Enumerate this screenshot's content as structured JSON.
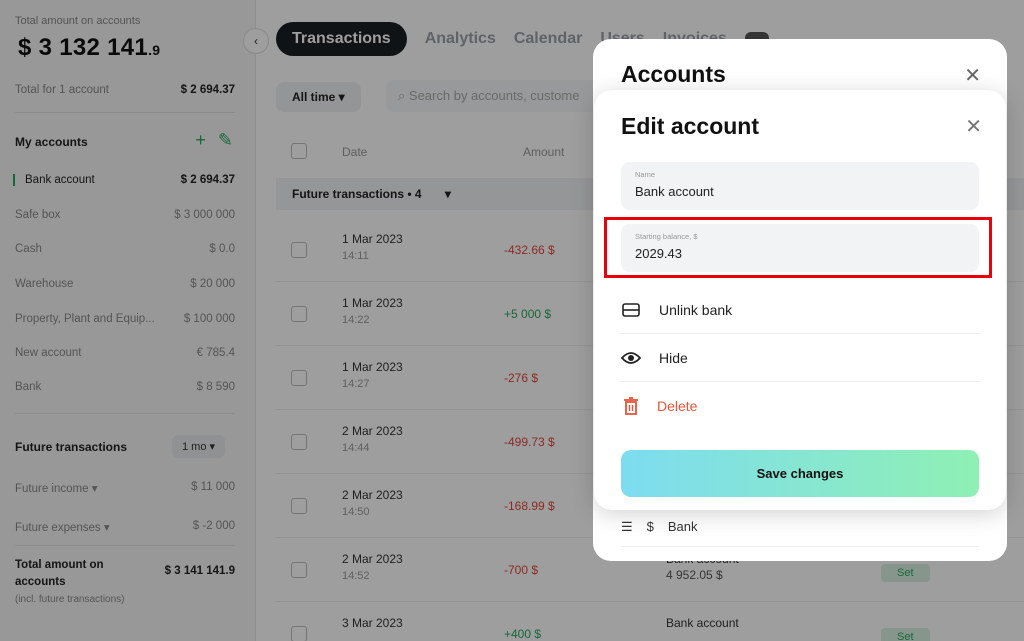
{
  "sidebar": {
    "total_label": "Total amount on accounts",
    "total_main": "$ 3 132 141",
    "total_frac": ".9",
    "total_for_label": "Total for 1 account",
    "total_for_value": "$ 2 694.37",
    "my_accounts_heading": "My accounts",
    "accounts": [
      {
        "name": "Bank account",
        "value": "$ 2 694.37"
      },
      {
        "name": "Safe box",
        "value": "$ 3 000 000"
      },
      {
        "name": "Cash",
        "value": "$ 0.0"
      },
      {
        "name": "Warehouse",
        "value": "$ 20 000"
      },
      {
        "name": "Property, Plant and Equip...",
        "value": "$ 100 000"
      },
      {
        "name": "New account",
        "value": "€ 785.4"
      },
      {
        "name": "Bank",
        "value": "$ 8 590"
      }
    ],
    "future_heading": "Future transactions",
    "future_period": "1 mo",
    "future_income_label": "Future income",
    "future_income_value": "$ 11 000",
    "future_expenses_label": "Future expenses",
    "future_expenses_value": "$ -2 000",
    "total_future_label": "Total amount on accounts",
    "total_future_value": "$ 3 141 141.9",
    "total_future_note": "(incl. future transactions)"
  },
  "tabs": [
    "Transactions",
    "Analytics",
    "Calendar",
    "Users",
    "Invoices"
  ],
  "filter": {
    "period": "All time",
    "search_placeholder": "Search by accounts, custome"
  },
  "table": {
    "headers": {
      "date": "Date",
      "amount": "Amount"
    },
    "group_label": "Future transactions • 4",
    "rows": [
      {
        "date": "1 Mar 2023",
        "time": "14:11",
        "amount": "-432.66 $",
        "sign": "neg",
        "account": "",
        "account_value": ""
      },
      {
        "date": "1 Mar 2023",
        "time": "14:22",
        "amount": "+5 000 $",
        "sign": "pos",
        "account": "",
        "account_value": ""
      },
      {
        "date": "1 Mar 2023",
        "time": "14:27",
        "amount": "-276 $",
        "sign": "neg",
        "account": "",
        "account_value": ""
      },
      {
        "date": "2 Mar 2023",
        "time": "14:44",
        "amount": "-499.73 $",
        "sign": "neg",
        "account": "",
        "account_value": ""
      },
      {
        "date": "2 Mar 2023",
        "time": "14:50",
        "amount": "-168.99 $",
        "sign": "neg",
        "account": "",
        "account_value": ""
      },
      {
        "date": "2 Mar 2023",
        "time": "14:52",
        "amount": "-700 $",
        "sign": "neg",
        "account": "Bank account",
        "account_value": "4 952.05 $"
      },
      {
        "date": "3 Mar 2023",
        "time": "",
        "amount": "+400 $",
        "sign": "pos",
        "account": "Bank account",
        "account_value": ""
      }
    ],
    "set_label": "Set"
  },
  "accounts_modal": {
    "title": "Accounts",
    "visible_row": {
      "currency": "$",
      "name": "Bank"
    }
  },
  "edit_modal": {
    "title": "Edit account",
    "name_label": "Name",
    "name_value": "Bank account",
    "balance_label": "Starting balance, $",
    "balance_value": "2029.43",
    "unlink_label": "Unlink bank",
    "hide_label": "Hide",
    "delete_label": "Delete",
    "save_label": "Save changes"
  },
  "colors": {
    "accent_green": "#26a65b",
    "negative": "#e0463a",
    "highlight": "#e8000b"
  }
}
